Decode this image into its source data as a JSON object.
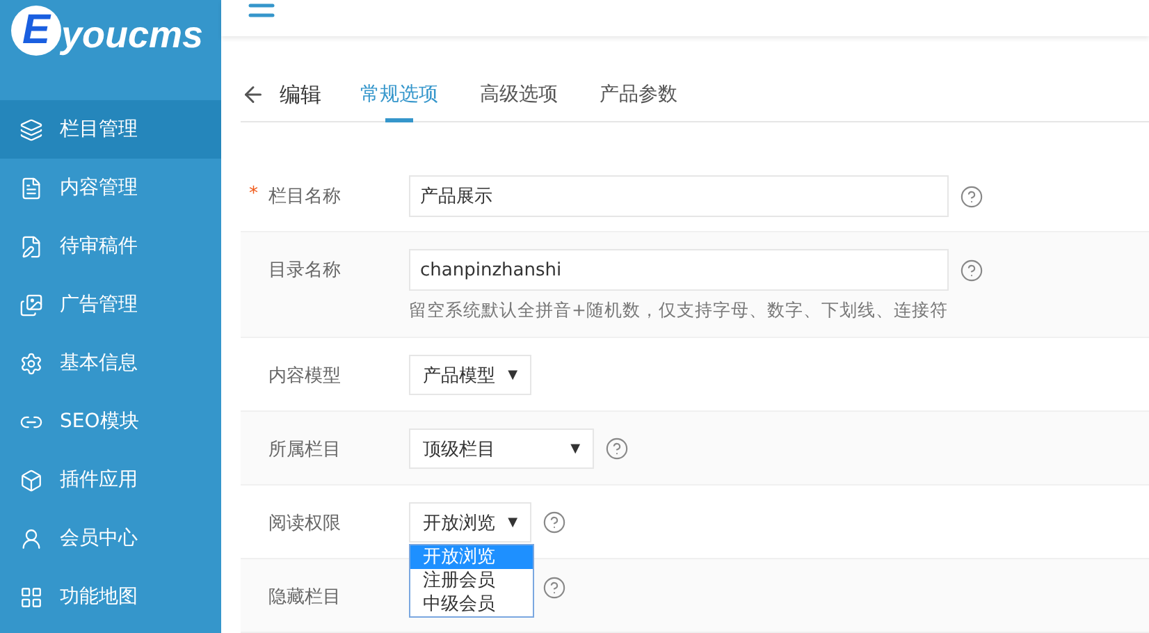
{
  "logo": {
    "initial": "E",
    "rest": "youcms"
  },
  "sidebar": {
    "items": [
      {
        "label": "栏目管理",
        "selected": true
      },
      {
        "label": "内容管理",
        "selected": false
      },
      {
        "label": "待审稿件",
        "selected": false
      },
      {
        "label": "广告管理",
        "selected": false
      },
      {
        "label": "基本信息",
        "selected": false
      },
      {
        "label": "SEO模块",
        "selected": false
      },
      {
        "label": "插件应用",
        "selected": false
      },
      {
        "label": "会员中心",
        "selected": false
      },
      {
        "label": "功能地图",
        "selected": false
      }
    ]
  },
  "header": {
    "back": "编辑",
    "tabs": [
      {
        "label": "常规选项",
        "selected": true
      },
      {
        "label": "高级选项",
        "selected": false
      },
      {
        "label": "产品参数",
        "selected": false
      }
    ]
  },
  "form": {
    "rows": [
      {
        "kind": "text",
        "label": "栏目名称",
        "required_mark": "*",
        "value": "产品展示",
        "help": true
      },
      {
        "kind": "text",
        "label": "目录名称",
        "value": "chanpinzhanshi",
        "help": true,
        "hint": "留空系统默认全拼音+随机数，仅支持字母、数字、下划线、连接符"
      },
      {
        "kind": "select",
        "label": "内容模型",
        "value": "产品模型",
        "caret": "▼",
        "help": false
      },
      {
        "kind": "select",
        "label": "所属栏目",
        "value": "顶级栏目",
        "caret": "▼",
        "help": true
      },
      {
        "kind": "select",
        "label": "阅读权限",
        "value": "开放浏览",
        "caret": "▼",
        "help": true,
        "options": [
          {
            "label": "开放浏览",
            "selected": true
          },
          {
            "label": "注册会员",
            "selected": false
          },
          {
            "label": "中级会员",
            "selected": false
          }
        ]
      },
      {
        "kind": "blank",
        "label": "隐藏栏目",
        "help": true
      }
    ]
  }
}
